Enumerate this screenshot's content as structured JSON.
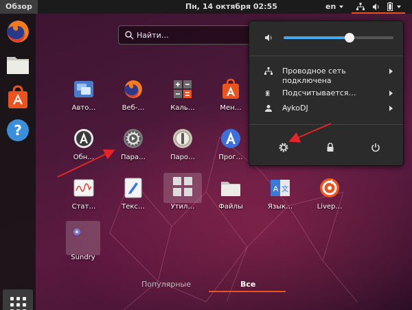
{
  "topbar": {
    "activities": "Обзор",
    "clock": "Пн, 14 октября  02:55",
    "language": "en"
  },
  "dock": {
    "items": [
      "firefox-icon",
      "files-icon",
      "software-center-icon",
      "help-icon"
    ],
    "show_apps": "apps-grid-icon"
  },
  "search": {
    "placeholder": "Найти…"
  },
  "apps": [
    {
      "label": "Авто…",
      "icon": "autostart-icon"
    },
    {
      "label": "Веб-…",
      "icon": "firefox-icon"
    },
    {
      "label": "Каль…",
      "icon": "calculator-icon"
    },
    {
      "label": "Мен…",
      "icon": "software-updater-icon"
    },
    {
      "label": "Обн…",
      "icon": "software-update-icon"
    },
    {
      "label": "Пара…",
      "icon": "settings-icon"
    },
    {
      "label": "Паро…",
      "icon": "passwords-icon"
    },
    {
      "label": "Прог…",
      "icon": "software-properties-icon"
    },
    {
      "label": "Стат…",
      "icon": "system-monitor-icon"
    },
    {
      "label": "Текс…",
      "icon": "text-editor-icon"
    },
    {
      "label": "Утил…",
      "icon": "utilities-folder-icon"
    },
    {
      "label": "Файлы",
      "icon": "files-icon"
    },
    {
      "label": "Язык…",
      "icon": "language-support-icon"
    },
    {
      "label": "Livep…",
      "icon": "livepatch-icon"
    },
    {
      "label": "Sundry",
      "icon": "sundry-folder-icon"
    }
  ],
  "switcher": {
    "popular": "Популярные",
    "all": "Все"
  },
  "system_menu": {
    "volume_level": 0.6,
    "network_line1": "Проводное сеть",
    "network_line2": "подключена",
    "battery": "Подсчитывается…",
    "user": "AykoDJ",
    "actions": [
      "settings-icon",
      "lock-icon",
      "power-icon"
    ]
  },
  "colors": {
    "accent": "#e95420",
    "volume": "#48a8f0",
    "arrow": "#e8232a"
  }
}
